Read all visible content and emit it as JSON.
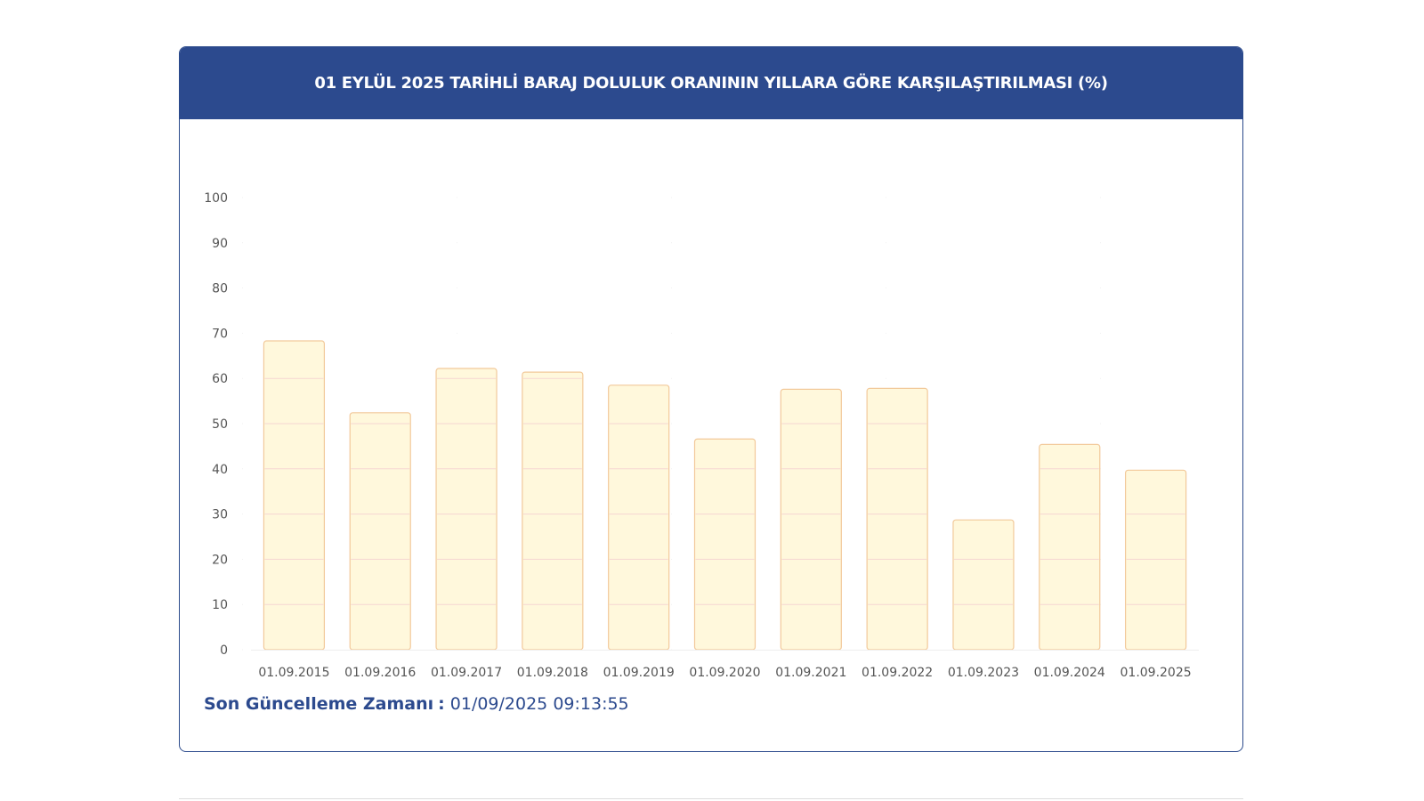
{
  "header": {
    "title": "01 EYLÜL 2025 TARİHLİ BARAJ DOLULUK ORANININ YILLARA GÖRE KARŞILAŞTIRILMASI (%)"
  },
  "footer": {
    "label": "Son Güncelleme Zamanı",
    "separator": ":",
    "value": "01/09/2025 09:13:55"
  },
  "colors": {
    "header_bg": "#2c4a8e",
    "bar_fill": "#fff8dc",
    "bar_stroke": "#f2c99a",
    "grid": "#f6d6d2",
    "tick_text": "#555555"
  },
  "chart_data": {
    "type": "bar",
    "title": "01 EYLÜL 2025 TARİHLİ BARAJ DOLULUK ORANININ YILLARA GÖRE KARŞILAŞTIRILMASI (%)",
    "categories": [
      "01.09.2015",
      "01.09.2016",
      "01.09.2017",
      "01.09.2018",
      "01.09.2019",
      "01.09.2020",
      "01.09.2021",
      "01.09.2022",
      "01.09.2023",
      "01.09.2024",
      "01.09.2025"
    ],
    "values": [
      68.3,
      52.4,
      62.2,
      61.4,
      58.5,
      46.6,
      57.6,
      57.8,
      28.7,
      45.4,
      39.7
    ],
    "yticks": [
      0,
      10,
      20,
      30,
      40,
      50,
      60,
      70,
      80,
      90,
      100
    ],
    "ylim": [
      0,
      100
    ],
    "xlabel": "",
    "ylabel": "",
    "grid": true,
    "legend": "none"
  }
}
